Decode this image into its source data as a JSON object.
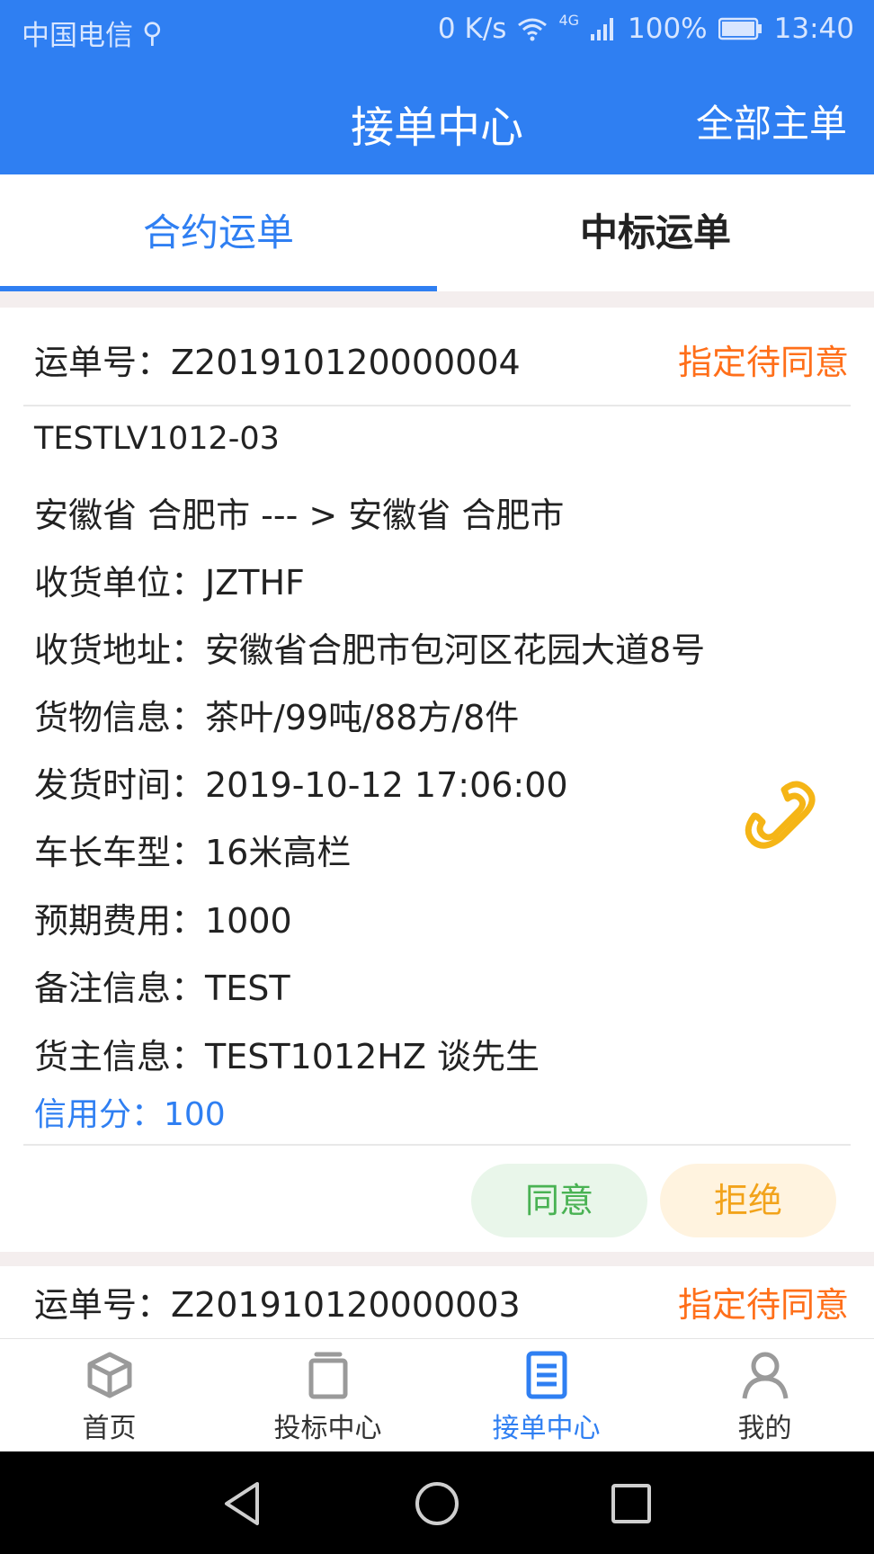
{
  "status_bar": {
    "carrier": "中国电信",
    "speed": "0 K/s",
    "network": "4G",
    "battery": "100%",
    "time": "13:40"
  },
  "header": {
    "title": "接单中心",
    "right_action": "全部主单"
  },
  "tabs": [
    {
      "label": "合约运单"
    },
    {
      "label": "中标运单"
    }
  ],
  "orders": [
    {
      "waybill_label": "运单号：",
      "waybill_no": "Z201910120000004",
      "status": "指定待同意",
      "code": "TESTLV1012-03",
      "route": "安徽省 合肥市  --- >  安徽省 合肥市",
      "receiver": "收货单位：JZTHF",
      "address": "收货地址：安徽省合肥市包河区花园大道8号",
      "goods": "货物信息：茶叶/99吨/88方/8件",
      "ship_time": "发货时间：2019-10-12 17:06:00",
      "vehicle": "车长车型：16米高栏",
      "expected_fee": "预期费用：1000",
      "remark": "备注信息：TEST",
      "shipper": "货主信息：TEST1012HZ  谈先生",
      "credit": "信用分：100",
      "agree_label": "同意",
      "refuse_label": "拒绝"
    },
    {
      "waybill_label": "运单号：",
      "waybill_no": "Z201910120000003",
      "status": "指定待同意"
    }
  ],
  "bottom_nav": [
    {
      "label": "首页",
      "icon": "cube-icon"
    },
    {
      "label": "投标中心",
      "icon": "stack-icon"
    },
    {
      "label": "接单中心",
      "icon": "document-icon"
    },
    {
      "label": "我的",
      "icon": "person-icon"
    }
  ],
  "colors": {
    "primary": "#2f7ff2",
    "status": "#ff6f1a",
    "agree": "#49b253",
    "refuse": "#f2a31b"
  }
}
